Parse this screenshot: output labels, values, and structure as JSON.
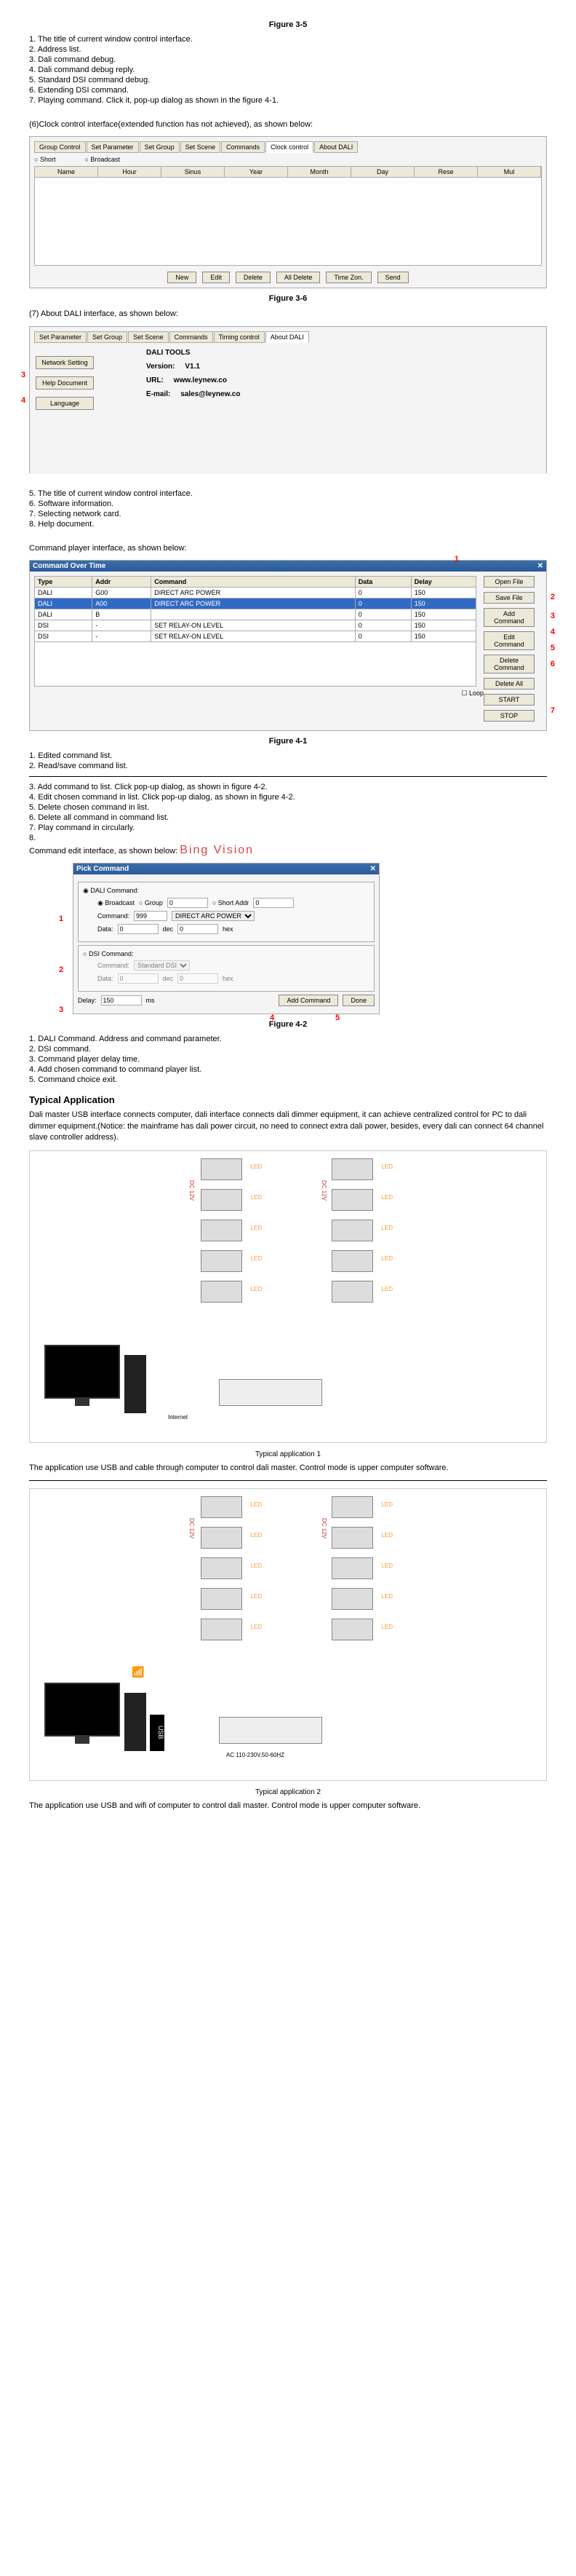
{
  "fig35": {
    "title": "Figure 3-5",
    "items": [
      "1.  The title of current window control interface.",
      "2.  Address list.",
      "3.  Dali command debug.",
      "4.  Dali command debug reply.",
      "5.  Standard DSI command debug.",
      "6.  Extending DSI command.",
      "7.  Playing command. Click it, pop-up dialog as shown in the figure 4-1."
    ],
    "line6": "(6)Clock control interface(extended function has not achieved), as shown below:"
  },
  "clock": {
    "tabs": [
      "Group Control",
      "Set Parameter",
      "Set Group",
      "Set Scene",
      "Commands",
      "Clock control",
      "About DALI"
    ],
    "radios": [
      "Short",
      "Broadcast"
    ],
    "cols": [
      "Name",
      "Hour",
      "Sinus",
      "Year",
      "Month",
      "Day",
      "Rese",
      "Mul"
    ],
    "buttons": [
      "New",
      "Edit",
      "Delete",
      "All Delete",
      "Time Zon.",
      "Send"
    ]
  },
  "fig36": {
    "title": "Figure 3-6",
    "intro": "(7) About DALI interface, as shown below:"
  },
  "about": {
    "tabs": [
      "Set Parameter",
      "Set Group",
      "Set Scene",
      "Commands",
      "Timing control",
      "About DALI"
    ],
    "netbtn": "Network Setting",
    "helpbtn": "Help Document",
    "langbtn": "Language",
    "title": "DALI  TOOLS",
    "version_l": "Version:",
    "version_v": "V1.1",
    "url_l": "URL:",
    "url_v": "www.leynew.co",
    "email_l": "E-mail:",
    "email_v": "sales@leynew.co",
    "items": [
      "5.  The title of current window control interface.",
      "6.  Software information.",
      "7.  Selecting network card.",
      "8.  Help document."
    ]
  },
  "cmdplayer": {
    "intro": "Command player interface, as shown below:",
    "title": "Command Over Time",
    "head": [
      "Type",
      "Addr",
      "Command",
      "Data",
      "Delay"
    ],
    "rows": [
      [
        "DALI",
        "G00",
        "DIRECT ARC POWER",
        "0",
        "150"
      ],
      [
        "DALI",
        "A00",
        "DIRECT ARC POWER",
        "0",
        "150"
      ],
      [
        "DALI",
        "B",
        "",
        "0",
        "150"
      ],
      [
        "DSI",
        "-",
        "SET RELAY-ON LEVEL",
        "0",
        "150"
      ],
      [
        "DSI",
        "-",
        "SET RELAY-ON LEVEL",
        "0",
        "150"
      ]
    ],
    "rightbtns": [
      "Open File",
      "Save File",
      "Add Command",
      "Edit Command",
      "Delete Command",
      "Delete All",
      "START",
      "STOP"
    ],
    "loop": "Loop"
  },
  "fig41": {
    "title": "Figure 4-1",
    "items": [
      "1.  Edited command list.",
      "2.  Read/save command list."
    ],
    "items2": [
      "3.  Add command to list. Click pop-up dialog, as shown in figure 4-2.",
      "4.  Edit chosen command in list. Click pop-up dialog, as shown in figure 4-2.",
      "5.  Delete chosen command in list.",
      "6.  Delete all command in command list.",
      "7.  Play command in circularly.",
      "8."
    ],
    "editline": "Command edit interface, as shown below:",
    "watermark": "Bing Vision"
  },
  "pick": {
    "title": "Pick  Command",
    "dali_cmd": "DALI Command:",
    "broadcast": "Broadcast",
    "group": "Group",
    "shortaddr": "Short Addr",
    "command_l": "Command:",
    "command_v": "DIRECT ARC POWER",
    "data_l": "Data:",
    "dec": "dec",
    "hex": "hex",
    "dsi_cmd": "DSI Command:",
    "std": "Standard DSI",
    "delay_l": "Delay:",
    "delay_v": "150",
    "ms": "ms",
    "add": "Add Command",
    "done": "Done",
    "nums": {
      "g": "0",
      "s": "0",
      "d0": "0",
      "d0h": "0",
      "c999": "999",
      "d2": "0",
      "h2": "0"
    }
  },
  "fig42": {
    "title": "Figure 4-2",
    "items": [
      "1.  DALI Command. Address and command parameter.",
      "2.  DSI command.",
      "3.  Command player delay time.",
      "4.  Add chosen command to command player list.",
      "5.  Command choice exit."
    ]
  },
  "typical": {
    "heading": "Typical Application",
    "para": "Dali master USB interface connects computer, dali interface connects dali dimmer equipment, it can achieve centralized control for PC to dali dimmer equipment.(Notice: the mainframe has dali power circuit, no need to connect extra dali power, besides, every dali can connect 64 channel slave controller address).",
    "cap1": "Typical application 1",
    "desc1": "The application use USB and cable through computer to control dali master. Control mode is upper computer software.",
    "cap2": "Typical application 2",
    "desc2": "The application use USB and wifi of computer to control dali master. Control mode is upper computer software.",
    "dc12": "DC 12V",
    "usb": "USB",
    "internet": "Internet",
    "ac": "AC 110-230V,50-60HZ"
  }
}
